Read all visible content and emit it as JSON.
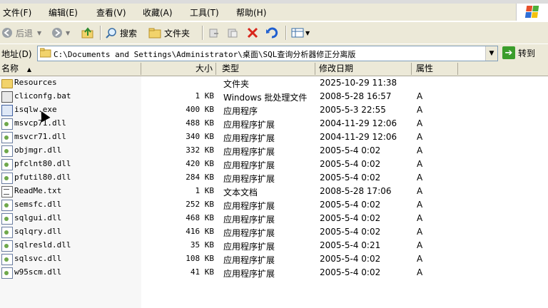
{
  "menu": [
    "文件(F)",
    "编辑(E)",
    "查看(V)",
    "收藏(A)",
    "工具(T)",
    "帮助(H)"
  ],
  "toolbar": {
    "back": "后退",
    "search": "搜索",
    "folders": "文件夹"
  },
  "address": {
    "label": "地址(D)",
    "path": "C:\\Documents and Settings\\Administrator\\桌面\\SQL查询分析器修正分离版",
    "go": "转到"
  },
  "columns": {
    "name": "名称",
    "size": "大小",
    "type": "类型",
    "modified": "修改日期",
    "attr": "属性"
  },
  "files": [
    {
      "name": "Resources",
      "size": "",
      "type": "文件夹",
      "modified": "2025-10-29 11:38",
      "attr": "",
      "icon": "folder-icon"
    },
    {
      "name": "cliconfg.bat",
      "size": "1 KB",
      "type": "Windows 批处理文件",
      "modified": "2008-5-28 16:57",
      "attr": "A",
      "icon": "bat-file-icon"
    },
    {
      "name": "isqlw.exe",
      "size": "400 KB",
      "type": "应用程序",
      "modified": "2005-5-3 22:55",
      "attr": "A",
      "icon": "exe-file-icon"
    },
    {
      "name": "msvcp71.dll",
      "size": "488 KB",
      "type": "应用程序扩展",
      "modified": "2004-11-29 12:06",
      "attr": "A",
      "icon": "dll-file-icon"
    },
    {
      "name": "msvcr71.dll",
      "size": "340 KB",
      "type": "应用程序扩展",
      "modified": "2004-11-29 12:06",
      "attr": "A",
      "icon": "dll-file-icon"
    },
    {
      "name": "objmgr.dll",
      "size": "332 KB",
      "type": "应用程序扩展",
      "modified": "2005-5-4 0:02",
      "attr": "A",
      "icon": "dll-file-icon"
    },
    {
      "name": "pfclnt80.dll",
      "size": "420 KB",
      "type": "应用程序扩展",
      "modified": "2005-5-4 0:02",
      "attr": "A",
      "icon": "dll-file-icon"
    },
    {
      "name": "pfutil80.dll",
      "size": "284 KB",
      "type": "应用程序扩展",
      "modified": "2005-5-4 0:02",
      "attr": "A",
      "icon": "dll-file-icon"
    },
    {
      "name": "ReadMe.txt",
      "size": "1 KB",
      "type": "文本文档",
      "modified": "2008-5-28 17:06",
      "attr": "A",
      "icon": "text-file-icon"
    },
    {
      "name": "semsfc.dll",
      "size": "252 KB",
      "type": "应用程序扩展",
      "modified": "2005-5-4 0:02",
      "attr": "A",
      "icon": "dll-file-icon"
    },
    {
      "name": "sqlgui.dll",
      "size": "468 KB",
      "type": "应用程序扩展",
      "modified": "2005-5-4 0:02",
      "attr": "A",
      "icon": "dll-file-icon"
    },
    {
      "name": "sqlqry.dll",
      "size": "416 KB",
      "type": "应用程序扩展",
      "modified": "2005-5-4 0:02",
      "attr": "A",
      "icon": "dll-file-icon"
    },
    {
      "name": "sqlresld.dll",
      "size": "35 KB",
      "type": "应用程序扩展",
      "modified": "2005-5-4 0:21",
      "attr": "A",
      "icon": "dll-file-icon"
    },
    {
      "name": "sqlsvc.dll",
      "size": "108 KB",
      "type": "应用程序扩展",
      "modified": "2005-5-4 0:02",
      "attr": "A",
      "icon": "dll-file-icon"
    },
    {
      "name": "w95scm.dll",
      "size": "41 KB",
      "type": "应用程序扩展",
      "modified": "2005-5-4 0:02",
      "attr": "A",
      "icon": "dll-file-icon"
    }
  ]
}
